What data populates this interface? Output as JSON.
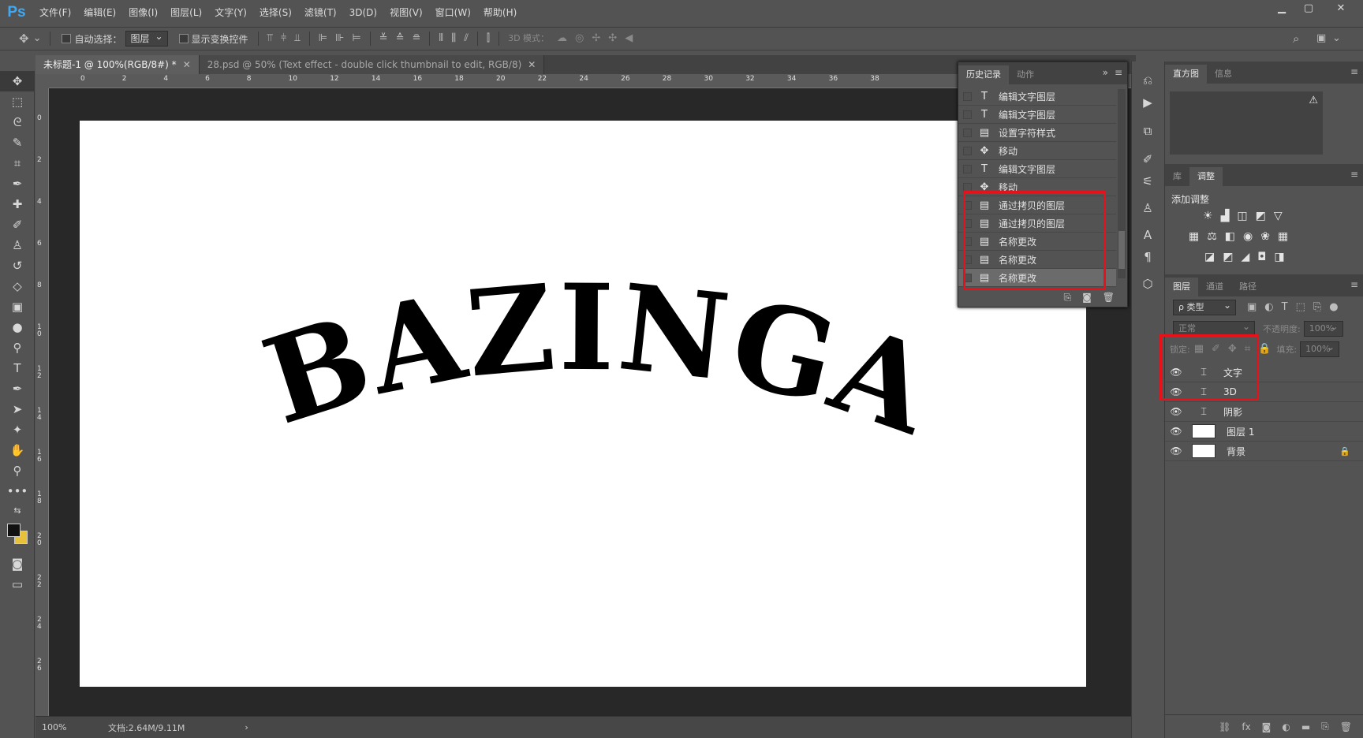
{
  "app": {
    "logo": "Ps"
  },
  "menu": [
    "文件(F)",
    "编辑(E)",
    "图像(I)",
    "图层(L)",
    "文字(Y)",
    "选择(S)",
    "滤镜(T)",
    "3D(D)",
    "视图(V)",
    "窗口(W)",
    "帮助(H)"
  ],
  "window_controls": {
    "minimize": "▁",
    "maximize": "▢",
    "close": "✕"
  },
  "options": {
    "auto_select_label": "自动选择：",
    "auto_select_value": "图层",
    "show_transform_label": "显示变换控件",
    "mode_3d_label": "3D 模式："
  },
  "tabs": [
    {
      "label": "未标题-1 @ 100%(RGB/8#) *",
      "close": "✕"
    },
    {
      "label": "28.psd @ 50% (Text effect - double click thumbnail to edit, RGB/8)",
      "close": "✕"
    }
  ],
  "ruler_h": [
    "0",
    "2",
    "4",
    "6",
    "8",
    "10",
    "12",
    "14",
    "16",
    "18",
    "20",
    "22",
    "24",
    "26",
    "28",
    "30",
    "32",
    "34",
    "36",
    "38"
  ],
  "ruler_v": [
    "0",
    "2",
    "4",
    "6",
    "8",
    "1\n0",
    "1\n2",
    "1\n4",
    "1\n6",
    "1\n8",
    "2\n0",
    "2\n2",
    "2\n4",
    "2\n6"
  ],
  "artwork": {
    "text": "BAZINGA!"
  },
  "status": {
    "zoom": "100%",
    "doc": "文档:2.64M/9.11M",
    "arrow": "›"
  },
  "history": {
    "tabs": [
      "历史记录",
      "动作"
    ],
    "expand": "»",
    "menu": "≡",
    "rows": [
      {
        "icon": "T",
        "label": "编辑文字图层"
      },
      {
        "icon": "T",
        "label": "编辑文字图层"
      },
      {
        "icon": "▤",
        "label": "设置字符样式"
      },
      {
        "icon": "✥",
        "label": "移动"
      },
      {
        "icon": "T",
        "label": "编辑文字图层"
      },
      {
        "icon": "✥",
        "label": "移动"
      },
      {
        "icon": "▤",
        "label": "通过拷贝的图层"
      },
      {
        "icon": "▤",
        "label": "通过拷贝的图层"
      },
      {
        "icon": "▤",
        "label": "名称更改"
      },
      {
        "icon": "▤",
        "label": "名称更改"
      },
      {
        "icon": "▤",
        "label": "名称更改"
      }
    ]
  },
  "histogram": {
    "tabs": [
      "直方图",
      "信息"
    ],
    "warn": "⚠"
  },
  "adjust": {
    "tabs": [
      "库",
      "调整"
    ],
    "title": "添加调整",
    "row1": [
      "☀",
      "▟",
      "◫",
      "◩",
      "▽"
    ],
    "row2": [
      "▦",
      "⚖",
      "◧",
      "◉",
      "❀",
      "▦"
    ],
    "row3": [
      "◪",
      "◩",
      "◢",
      "◘",
      "◨"
    ]
  },
  "layers": {
    "tabs": [
      "图层",
      "通道",
      "路径"
    ],
    "filter": "ρ 类型",
    "blend": "正常",
    "opacity_label": "不透明度:",
    "opacity_value": "100%",
    "lock_label": "锁定:",
    "fill_label": "填充:",
    "fill_value": "100%",
    "rows": [
      {
        "name": "文字",
        "kind": "text"
      },
      {
        "name": "3D",
        "kind": "text"
      },
      {
        "name": "阴影",
        "kind": "text"
      },
      {
        "name": "图层 1",
        "kind": "pixel"
      },
      {
        "name": "背景",
        "kind": "pixel",
        "locked": "🔒"
      }
    ]
  },
  "colors": {
    "accent_red": "#e8111a",
    "ps_blue": "#3ea9f5",
    "bg_swatch": "#e8c13a"
  }
}
